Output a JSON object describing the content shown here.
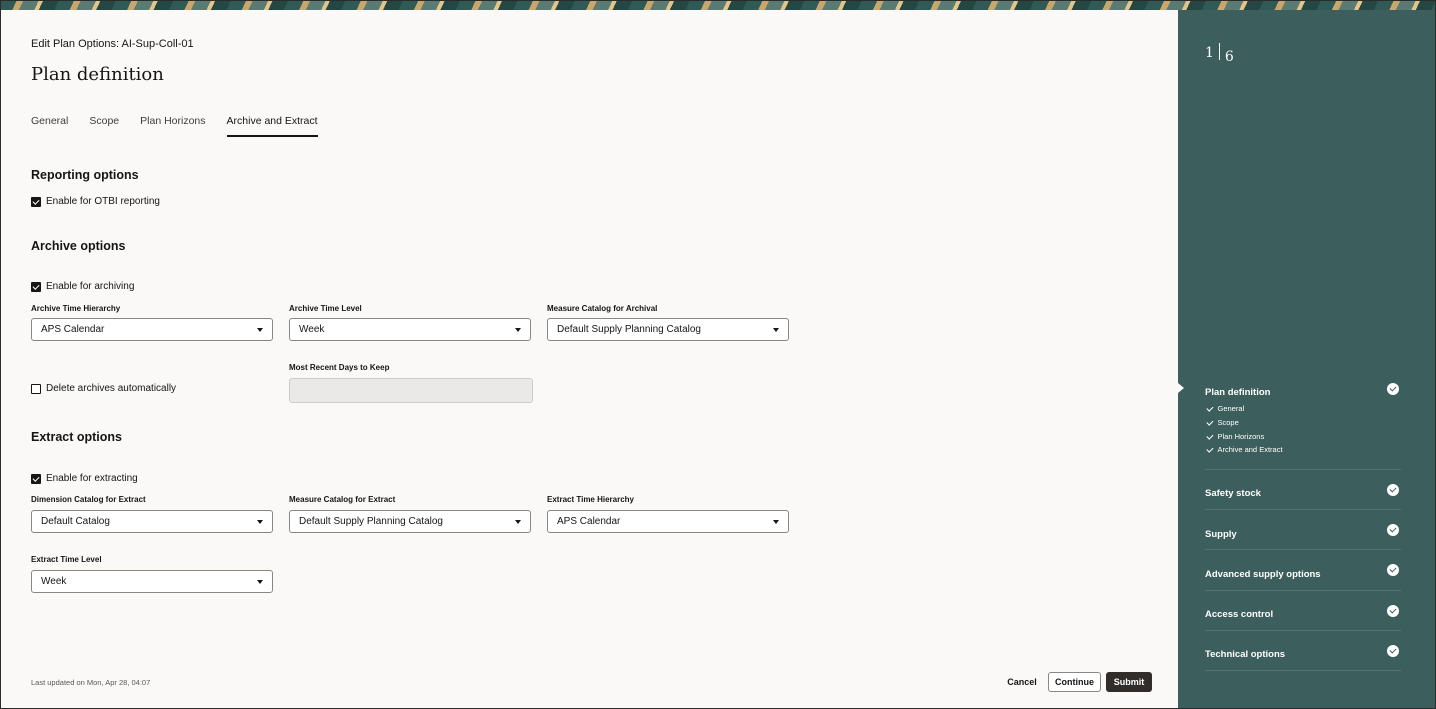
{
  "header": {
    "breadcrumb": "Edit Plan Options: AI-Sup-Coll-01",
    "title": "Plan definition"
  },
  "tabs": [
    {
      "label": "General",
      "active": false
    },
    {
      "label": "Scope",
      "active": false
    },
    {
      "label": "Plan Horizons",
      "active": false
    },
    {
      "label": "Archive and Extract",
      "active": true
    }
  ],
  "reporting": {
    "heading": "Reporting options",
    "otbi_label": "Enable for OTBI reporting",
    "otbi_checked": true
  },
  "archive": {
    "heading": "Archive options",
    "enable_label": "Enable for archiving",
    "enable_checked": true,
    "time_hierarchy": {
      "label": "Archive Time Hierarchy",
      "value": "APS Calendar"
    },
    "time_level": {
      "label": "Archive Time Level",
      "value": "Week"
    },
    "measure_catalog": {
      "label": "Measure Catalog for Archival",
      "value": "Default Supply Planning Catalog"
    },
    "delete_label": "Delete archives automatically",
    "delete_checked": false,
    "recent_days": {
      "label": "Most Recent Days to Keep",
      "value": ""
    }
  },
  "extract": {
    "heading": "Extract options",
    "enable_label": "Enable for extracting",
    "enable_checked": true,
    "dimension_catalog": {
      "label": "Dimension Catalog for Extract",
      "value": "Default Catalog"
    },
    "measure_catalog": {
      "label": "Measure Catalog for Extract",
      "value": "Default Supply Planning Catalog"
    },
    "time_hierarchy": {
      "label": "Extract Time Hierarchy",
      "value": "APS Calendar"
    },
    "time_level": {
      "label": "Extract Time Level",
      "value": "Week"
    }
  },
  "footer": {
    "updated": "Last updated on Mon, Apr 28, 04:07",
    "cancel": "Cancel",
    "continue": "Continue",
    "submit": "Submit"
  },
  "sidebar": {
    "counter_current": "1",
    "counter_total": "6",
    "steps": [
      {
        "title": "Plan definition",
        "complete": true,
        "subitems": [
          "General",
          "Scope",
          "Plan Horizons",
          "Archive and Extract"
        ]
      },
      {
        "title": "Safety stock",
        "complete": true
      },
      {
        "title": "Supply",
        "complete": true
      },
      {
        "title": "Advanced supply options",
        "complete": true
      },
      {
        "title": "Access control",
        "complete": true
      },
      {
        "title": "Technical options",
        "complete": true
      }
    ]
  },
  "colors": {
    "sidebar_bg": "#3c5e5c",
    "page_bg": "#fbf9f8",
    "submit_bg": "#312d2a"
  }
}
